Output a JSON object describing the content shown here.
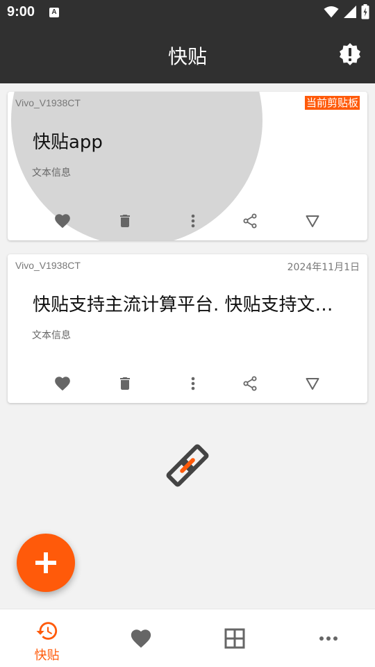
{
  "status_bar": {
    "time": "9:00",
    "notification_glyph": "A"
  },
  "app_bar": {
    "title": "快贴",
    "action_icon": "alert-badge-icon"
  },
  "clips": [
    {
      "device": "Vivo_V1938CT",
      "badge": "当前剪贴板",
      "content": "快贴app",
      "type": "文本信息",
      "pressed": true
    },
    {
      "device": "Vivo_V1938CT",
      "date": "2024年11月1日",
      "content": "快贴支持主流计算平台. 快贴支持文本/图片/文件",
      "type": "文本信息",
      "pressed": false
    }
  ],
  "bottom_nav": {
    "items": [
      {
        "icon": "history-icon",
        "label": "快贴",
        "active": true
      },
      {
        "icon": "heart-icon",
        "label": "",
        "active": false
      },
      {
        "icon": "grid-icon",
        "label": "",
        "active": false
      },
      {
        "icon": "more-icon",
        "label": "",
        "active": false
      }
    ]
  },
  "colors": {
    "accent": "#ff5a0a",
    "app_bar": "#303030",
    "background": "#f2f2f2",
    "icon_gray": "#666666"
  }
}
